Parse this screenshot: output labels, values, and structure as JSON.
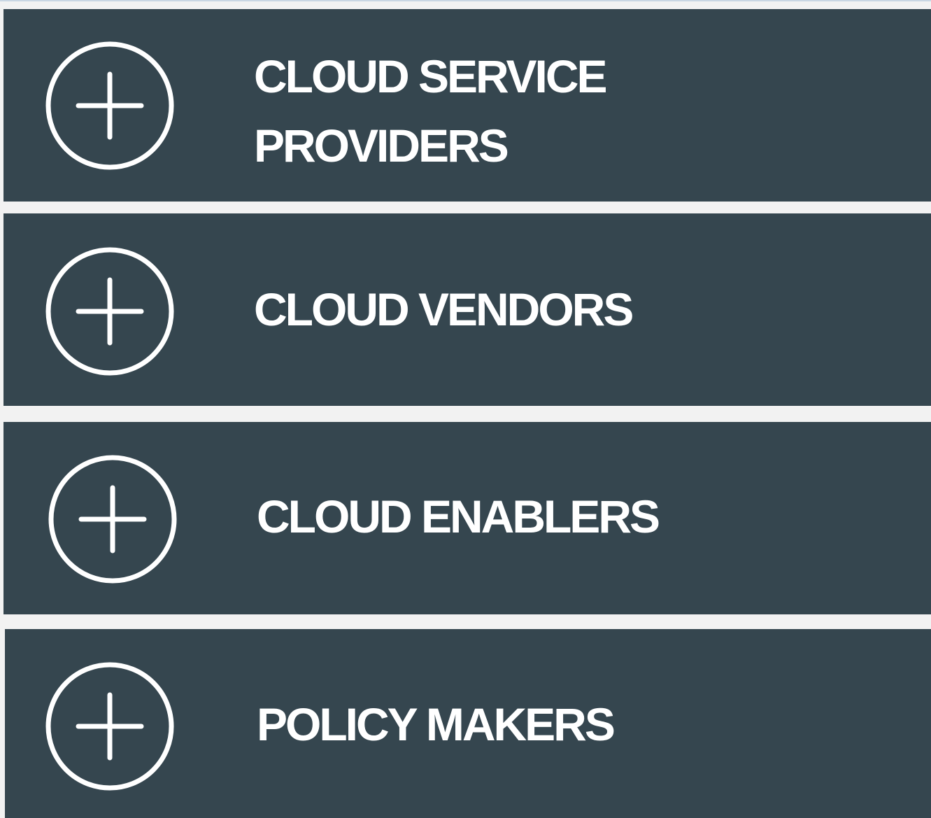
{
  "accordion": {
    "items": [
      {
        "label": "CLOUD SERVICE PROVIDERS",
        "icon": "plus-circle-icon"
      },
      {
        "label": "CLOUD VENDORS",
        "icon": "plus-circle-icon"
      },
      {
        "label": "CLOUD ENABLERS",
        "icon": "plus-circle-icon"
      },
      {
        "label": "POLICY MAKERS",
        "icon": "plus-circle-icon"
      }
    ]
  },
  "colors": {
    "panel_background": "#35464f",
    "page_background": "#f2f2f2",
    "text": "#ffffff",
    "icon_stroke": "#ffffff"
  }
}
